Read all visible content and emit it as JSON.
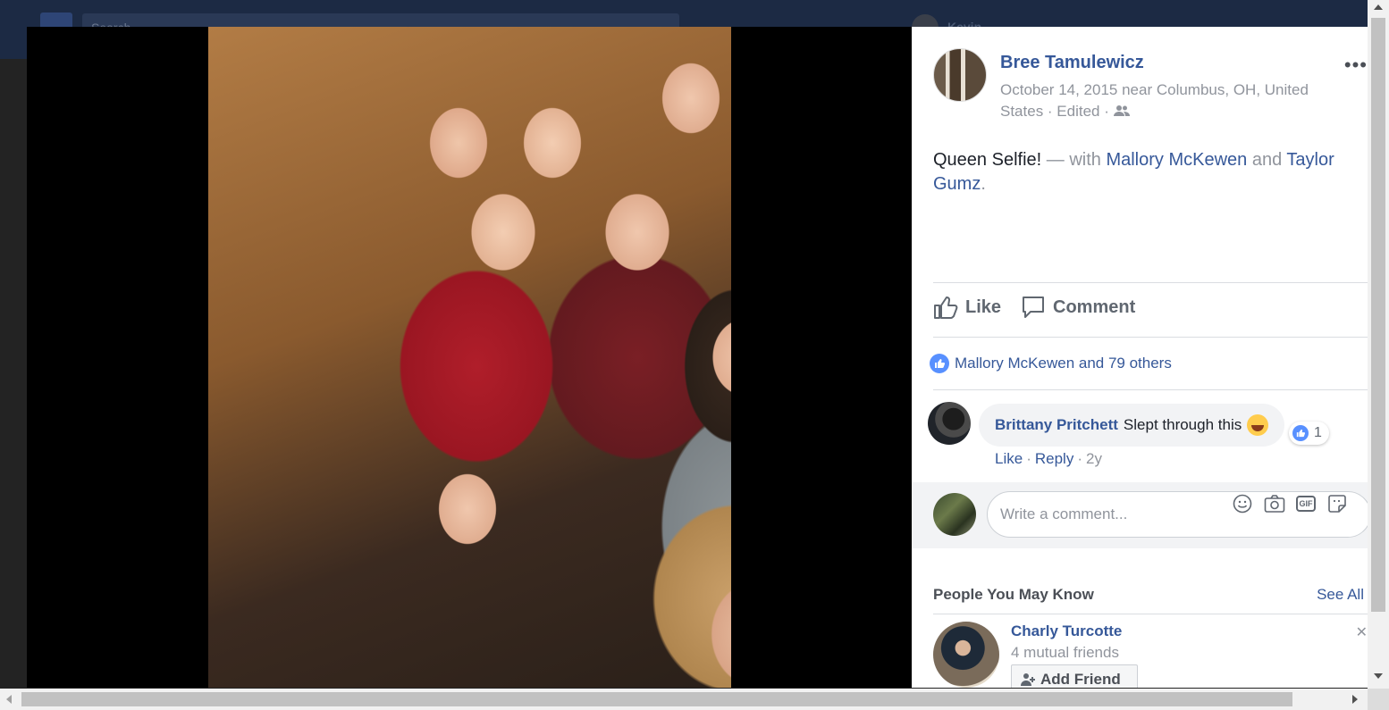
{
  "topbar": {
    "search_placeholder": "Search",
    "user_name": "Kevin"
  },
  "post": {
    "author": "Bree Tamulewicz",
    "meta": "October 14, 2015 near Columbus, OH, United States · Edited ·",
    "text": "Queen Selfie!",
    "with_prefix": "— with",
    "tag1": "Mallory McKewen",
    "and": "and",
    "tag2": "Taylor Gumz",
    "period": "."
  },
  "actions": {
    "like": "Like",
    "comment": "Comment"
  },
  "likes_summary": "Mallory McKewen and 79 others",
  "comment": {
    "author": "Brittany Pritchett",
    "text": "Slept through this",
    "reaction_count": "1",
    "like": "Like",
    "reply": "Reply",
    "time": "2y",
    "sep": "·"
  },
  "composer": {
    "placeholder": "Write a comment..."
  },
  "pymk": {
    "title": "People You May Know",
    "see_all": "See All",
    "person_name": "Charly Turcotte",
    "mutual": "4 mutual friends",
    "add_friend": "Add Friend"
  },
  "colors": {
    "link": "#365899",
    "like_blue": "#5890ff",
    "muted": "#90949c"
  }
}
